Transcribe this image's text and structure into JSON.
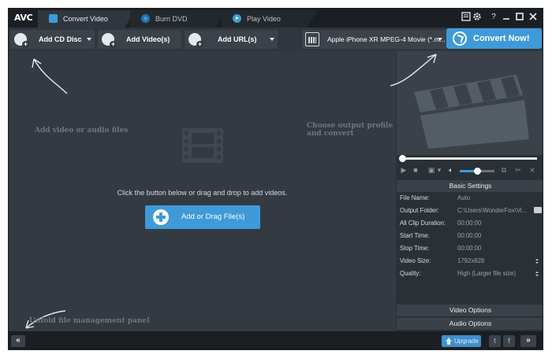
{
  "app": {
    "logo": "AVC"
  },
  "tabs": [
    {
      "label": "Convert Video",
      "icon": "convert-icon",
      "active": true
    },
    {
      "label": "Burn DVD",
      "icon": "disc-icon",
      "active": false
    },
    {
      "label": "Play Video",
      "icon": "play-icon",
      "active": false
    }
  ],
  "toolbar": {
    "add_cd": "Add CD Disc",
    "add_video": "Add Video(s)",
    "add_url": "Add URL(s)",
    "profile": "Apple iPhone XR MPEG-4 Movie (*.m...",
    "convert": "Convert Now!"
  },
  "main": {
    "hint_add": "Add video or audio files",
    "hint_profile": "Choose output profile and convert",
    "hint_unfold": "Unfold file management panel",
    "drop_text": "Click the button below or drag and drop to add videos.",
    "add_button": "Add or Drag File(s)"
  },
  "player": {
    "progress": 0,
    "volume": 0.5
  },
  "settings": {
    "header": "Basic Settings",
    "rows": [
      {
        "label": "File Name:",
        "value": "Auto"
      },
      {
        "label": "Output Folder:",
        "value": "C:\\Users\\WonderFox\\Vi..."
      },
      {
        "label": "All Clip Duration:",
        "value": "00:00:00"
      },
      {
        "label": "Start Time:",
        "value": "00:00:00"
      },
      {
        "label": "Stop Time:",
        "value": "00:00:00"
      },
      {
        "label": "Video Size:",
        "value": "1792x828"
      },
      {
        "label": "Quality:",
        "value": "High (Larger file size)"
      }
    ],
    "video_options": "Video Options",
    "audio_options": "Audio Options"
  },
  "bottom": {
    "collapse": "«",
    "upgrade": "Upgrade",
    "twitter": "t",
    "facebook": "f",
    "expand": "»"
  },
  "window_controls": {
    "help": "?"
  },
  "colors": {
    "accent": "#3f9ad9",
    "background": "#2c3238",
    "titlebar": "#1b1f24"
  }
}
